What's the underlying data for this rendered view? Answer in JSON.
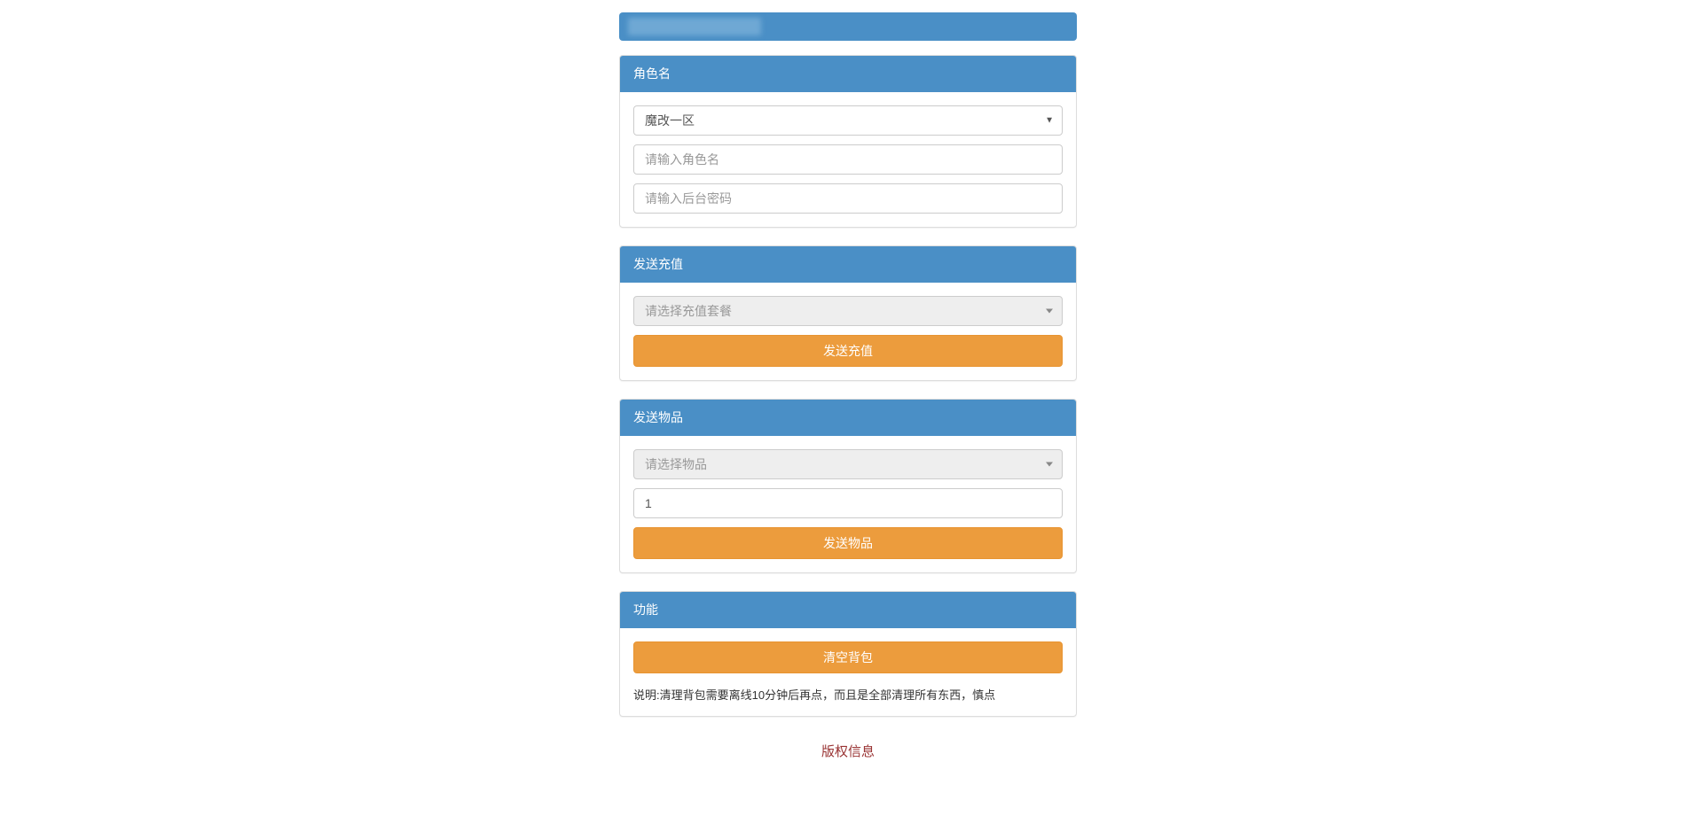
{
  "panels": {
    "character": {
      "title": "角色名",
      "serverSelected": "魔改一区",
      "namePlaceholder": "请输入角色名",
      "passwordPlaceholder": "请输入后台密码"
    },
    "recharge": {
      "title": "发送充值",
      "selectPlaceholder": "请选择充值套餐",
      "buttonLabel": "发送充值"
    },
    "item": {
      "title": "发送物品",
      "selectPlaceholder": "请选择物品",
      "quantityValue": "1",
      "buttonLabel": "发送物品"
    },
    "functions": {
      "title": "功能",
      "clearBagLabel": "清空背包",
      "note": "说明:清理背包需要离线10分钟后再点，而且是全部清理所有东西，慎点"
    }
  },
  "footer": "版权信息"
}
